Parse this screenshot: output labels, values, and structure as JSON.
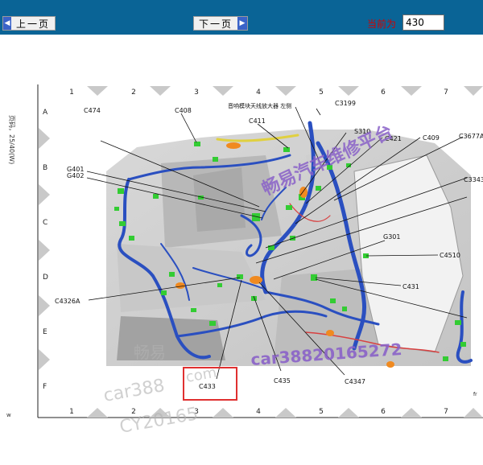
{
  "toolbar": {
    "prev_label": "上一页",
    "next_label": "下一页",
    "page_label": "当前为",
    "page_value": "430"
  },
  "sheet": {
    "side_note": "页码，25/40(W)",
    "title": "音响模块天线放大器 左侧",
    "columns": [
      "1",
      "2",
      "3",
      "4",
      "5",
      "6",
      "7"
    ],
    "rows": [
      "A",
      "B",
      "C",
      "D",
      "E",
      "F"
    ],
    "callouts": {
      "c474": "C474",
      "c408": "C408",
      "c411": "C411",
      "c3199": "C3199",
      "s310": "S310",
      "c421": "C421",
      "c409": "C409",
      "c3677a": "C3677A",
      "g401": "G401",
      "g402": "G402",
      "c3343": "C3343",
      "g301": "G301",
      "c4510": "C4510",
      "c431": "C431",
      "c4326a": "C4326A",
      "c435": "C435",
      "c4347": "C4347",
      "c433": "C433"
    },
    "watermarks": {
      "top": "畅易汽车维修平台",
      "bottom_left": "畅易",
      "car388": "car388",
      "com": "com",
      "cy": "CY20165",
      "phone": "car38820165272"
    },
    "corner_small": "fr"
  },
  "colors": {
    "toolbar": "#0a6496",
    "highlight": "#e03030",
    "harness": "#2a4fc0",
    "connector": "#33cc33",
    "watermark": "#8a62c8"
  }
}
